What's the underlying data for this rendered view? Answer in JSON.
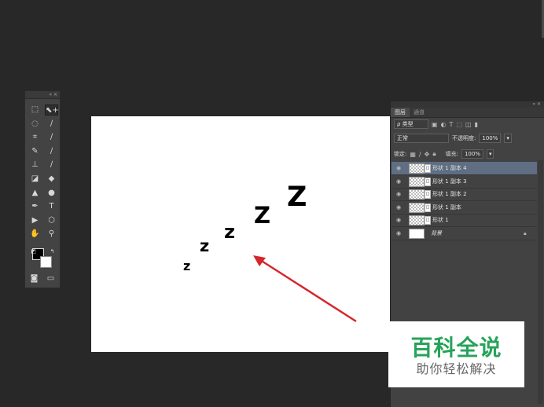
{
  "tools_panel": {
    "header_glyphs": "«  ×",
    "tools": [
      {
        "name": "marquee-tool-icon",
        "glyph": "⬚"
      },
      {
        "name": "move-tool-icon",
        "glyph": "⬉+",
        "selected": true
      },
      {
        "name": "lasso-tool-icon",
        "glyph": "◌"
      },
      {
        "name": "quick-select-tool-icon",
        "glyph": "∕"
      },
      {
        "name": "crop-tool-icon",
        "glyph": "⌗"
      },
      {
        "name": "eyedropper-tool-icon",
        "glyph": "∕"
      },
      {
        "name": "healing-brush-tool-icon",
        "glyph": "✎"
      },
      {
        "name": "brush-tool-icon",
        "glyph": "∕"
      },
      {
        "name": "clone-stamp-tool-icon",
        "glyph": "⊥"
      },
      {
        "name": "history-brush-tool-icon",
        "glyph": "∕"
      },
      {
        "name": "eraser-tool-icon",
        "glyph": "◪"
      },
      {
        "name": "paint-bucket-tool-icon",
        "glyph": "◆"
      },
      {
        "name": "blur-tool-icon",
        "glyph": "▲"
      },
      {
        "name": "dodge-tool-icon",
        "glyph": "●"
      },
      {
        "name": "pen-tool-icon",
        "glyph": "✒"
      },
      {
        "name": "type-tool-icon",
        "glyph": "T"
      },
      {
        "name": "path-select-tool-icon",
        "glyph": "▶"
      },
      {
        "name": "shape-tool-icon",
        "glyph": "⬡"
      },
      {
        "name": "hand-tool-icon",
        "glyph": "✋"
      },
      {
        "name": "zoom-tool-icon",
        "glyph": "⚲"
      }
    ],
    "bottom_icons": [
      {
        "name": "quick-mask-icon",
        "glyph": "◙"
      },
      {
        "name": "screen-mode-icon",
        "glyph": "▭"
      }
    ]
  },
  "canvas": {
    "letters": [
      "z",
      "z",
      "z",
      "Z",
      "Z"
    ],
    "arrow_color": "#d6262b"
  },
  "layers_panel": {
    "header_glyphs": "« ×",
    "tabs": [
      "图层",
      "通道"
    ],
    "filter_label": "ρ 类型",
    "blend_mode": "正常",
    "opacity_label": "不透明度:",
    "opacity_value": "100%",
    "lock_label": "锁定:",
    "fill_label": "填充:",
    "fill_value": "100%",
    "layers": [
      {
        "name": "形状 1 副本 4",
        "active": true,
        "type": "shape"
      },
      {
        "name": "形状 1 副本 3",
        "active": false,
        "type": "shape"
      },
      {
        "name": "形状 1 副本 2",
        "active": false,
        "type": "shape"
      },
      {
        "name": "形状 1 副本",
        "active": false,
        "type": "shape"
      },
      {
        "name": "形状 1",
        "active": false,
        "type": "shape"
      },
      {
        "name": "背景",
        "active": false,
        "type": "background"
      }
    ]
  },
  "watermark": {
    "title": "百科全说",
    "subtitle": "助你轻松解决",
    "title_color": "#27a35a"
  }
}
